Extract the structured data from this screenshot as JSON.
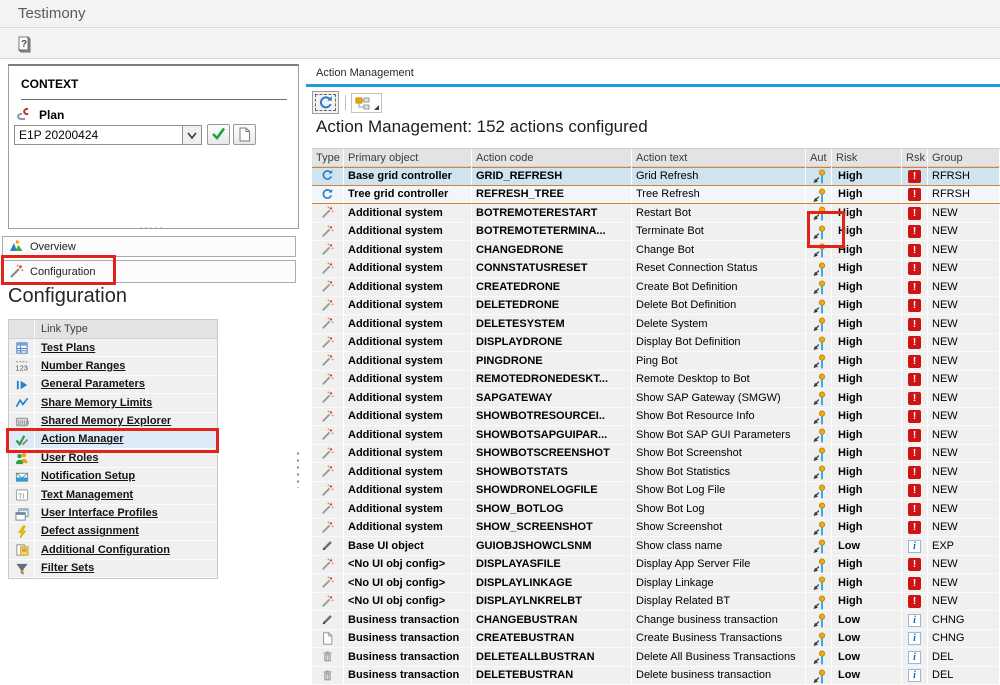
{
  "window": {
    "title": "Testimony"
  },
  "menubar": {
    "help_icon": "help-icon"
  },
  "context": {
    "title": "CONTEXT",
    "plan_label": "Plan",
    "plan_value": "E1P 20200424",
    "buttons": {
      "confirm": "check-icon",
      "create": "new-document-icon"
    }
  },
  "nav": {
    "overview_label": "Overview",
    "configuration_label": "Configuration"
  },
  "sidebar": {
    "heading": "Configuration",
    "column_header": "Link Type",
    "links": [
      {
        "label": "Test Plans",
        "icon": "test-plans-icon",
        "selected": false
      },
      {
        "label": "Number Ranges",
        "icon": "number-ranges-icon",
        "selected": false
      },
      {
        "label": "General Parameters",
        "icon": "general-parameters-icon",
        "selected": false
      },
      {
        "label": "Share Memory Limits",
        "icon": "share-memory-limits-icon",
        "selected": false
      },
      {
        "label": "Shared Memory Explorer",
        "icon": "shared-memory-explorer-icon",
        "selected": false
      },
      {
        "label": "Action Manager",
        "icon": "action-manager-icon",
        "selected": true
      },
      {
        "label": "User Roles",
        "icon": "user-roles-icon",
        "selected": false
      },
      {
        "label": "Notification Setup",
        "icon": "notification-setup-icon",
        "selected": false
      },
      {
        "label": "Text Management",
        "icon": "text-management-icon",
        "selected": false
      },
      {
        "label": "User Interface Profiles",
        "icon": "user-interface-profiles-icon",
        "selected": false
      },
      {
        "label": "Defect assignment",
        "icon": "defect-assignment-icon",
        "selected": false
      },
      {
        "label": "Additional Configuration",
        "icon": "additional-configuration-icon",
        "selected": false
      },
      {
        "label": "Filter Sets",
        "icon": "filter-sets-icon",
        "selected": false
      }
    ]
  },
  "main": {
    "tab_title": "Action Management",
    "toolbar": {
      "refresh_icon": "refresh-icon",
      "layout_icon": "layout-icon"
    },
    "heading": "Action Management: 152  actions configured",
    "table": {
      "columns": [
        "Type",
        "Primary object",
        "Action code",
        "Action text",
        "Aut",
        "Risk",
        "Rsk",
        "Group"
      ],
      "rows": [
        {
          "type_icon": "refresh-icon",
          "primary": "Base grid controller",
          "code": "GRID_REFRESH",
          "text": "Grid Refresh",
          "aut_icon": "authorization-key-icon",
          "risk": "High",
          "rsk_icon": "error-icon",
          "group": "RFRSH",
          "selection": "lead"
        },
        {
          "type_icon": "refresh-icon",
          "primary": "Tree grid controller",
          "code": "REFRESH_TREE",
          "text": "Tree Refresh",
          "aut_icon": "authorization-key-icon",
          "risk": "High",
          "rsk_icon": "error-icon",
          "group": "RFRSH",
          "selection": "second"
        },
        {
          "type_icon": "wand-icon",
          "primary": "Additional system",
          "code": "BOTREMOTERESTART",
          "text": "Restart Bot",
          "aut_icon": "authorization-key-icon",
          "risk": "High",
          "rsk_icon": "error-icon",
          "group": "NEW"
        },
        {
          "type_icon": "wand-icon",
          "primary": "Additional system",
          "code": "BOTREMOTETERMINA...",
          "text": "Terminate Bot",
          "aut_icon": "authorization-key-icon",
          "risk": "High",
          "rsk_icon": "error-icon",
          "group": "NEW"
        },
        {
          "type_icon": "wand-icon",
          "primary": "Additional system",
          "code": "CHANGEDRONE",
          "text": "Change Bot",
          "aut_icon": "authorization-key-icon",
          "risk": "High",
          "rsk_icon": "error-icon",
          "group": "NEW"
        },
        {
          "type_icon": "wand-icon",
          "primary": "Additional system",
          "code": "CONNSTATUSRESET",
          "text": "Reset Connection Status",
          "aut_icon": "authorization-key-icon",
          "risk": "High",
          "rsk_icon": "error-icon",
          "group": "NEW"
        },
        {
          "type_icon": "wand-icon",
          "primary": "Additional system",
          "code": "CREATEDRONE",
          "text": "Create Bot Definition",
          "aut_icon": "authorization-key-icon",
          "risk": "High",
          "rsk_icon": "error-icon",
          "group": "NEW"
        },
        {
          "type_icon": "wand-icon",
          "primary": "Additional system",
          "code": "DELETEDRONE",
          "text": "Delete Bot Definition",
          "aut_icon": "authorization-key-icon",
          "risk": "High",
          "rsk_icon": "error-icon",
          "group": "NEW"
        },
        {
          "type_icon": "wand-icon",
          "primary": "Additional system",
          "code": "DELETESYSTEM",
          "text": "Delete System",
          "aut_icon": "authorization-key-icon",
          "risk": "High",
          "rsk_icon": "error-icon",
          "group": "NEW"
        },
        {
          "type_icon": "wand-icon",
          "primary": "Additional system",
          "code": "DISPLAYDRONE",
          "text": "Display Bot Definition",
          "aut_icon": "authorization-key-icon",
          "risk": "High",
          "rsk_icon": "error-icon",
          "group": "NEW"
        },
        {
          "type_icon": "wand-icon",
          "primary": "Additional system",
          "code": "PINGDRONE",
          "text": "Ping Bot",
          "aut_icon": "authorization-key-icon",
          "risk": "High",
          "rsk_icon": "error-icon",
          "group": "NEW"
        },
        {
          "type_icon": "wand-icon",
          "primary": "Additional system",
          "code": "REMOTEDRONEDESKT...",
          "text": "Remote Desktop to Bot",
          "aut_icon": "authorization-key-icon",
          "risk": "High",
          "rsk_icon": "error-icon",
          "group": "NEW"
        },
        {
          "type_icon": "wand-icon",
          "primary": "Additional system",
          "code": "SAPGATEWAY",
          "text": "Show SAP Gateway (SMGW)",
          "aut_icon": "authorization-key-icon",
          "risk": "High",
          "rsk_icon": "error-icon",
          "group": "NEW"
        },
        {
          "type_icon": "wand-icon",
          "primary": "Additional system",
          "code": "SHOWBOTRESOURCEI..",
          "text": "Show Bot Resource Info",
          "aut_icon": "authorization-key-icon",
          "risk": "High",
          "rsk_icon": "error-icon",
          "group": "NEW"
        },
        {
          "type_icon": "wand-icon",
          "primary": "Additional system",
          "code": "SHOWBOTSAPGUIPAR...",
          "text": "Show Bot SAP GUI Parameters",
          "aut_icon": "authorization-key-icon",
          "risk": "High",
          "rsk_icon": "error-icon",
          "group": "NEW"
        },
        {
          "type_icon": "wand-icon",
          "primary": "Additional system",
          "code": "SHOWBOTSCREENSHOT",
          "text": "Show Bot Screenshot",
          "aut_icon": "authorization-key-icon",
          "risk": "High",
          "rsk_icon": "error-icon",
          "group": "NEW"
        },
        {
          "type_icon": "wand-icon",
          "primary": "Additional system",
          "code": "SHOWBOTSTATS",
          "text": "Show Bot Statistics",
          "aut_icon": "authorization-key-icon",
          "risk": "High",
          "rsk_icon": "error-icon",
          "group": "NEW"
        },
        {
          "type_icon": "wand-icon",
          "primary": "Additional system",
          "code": "SHOWDRONELOGFILE",
          "text": "Show Bot Log File",
          "aut_icon": "authorization-key-icon",
          "risk": "High",
          "rsk_icon": "error-icon",
          "group": "NEW"
        },
        {
          "type_icon": "wand-icon",
          "primary": "Additional system",
          "code": "SHOW_BOTLOG",
          "text": "Show Bot Log",
          "aut_icon": "authorization-key-icon",
          "risk": "High",
          "rsk_icon": "error-icon",
          "group": "NEW"
        },
        {
          "type_icon": "wand-icon",
          "primary": "Additional system",
          "code": "SHOW_SCREENSHOT",
          "text": "Show Screenshot",
          "aut_icon": "authorization-key-icon",
          "risk": "High",
          "rsk_icon": "error-icon",
          "group": "NEW"
        },
        {
          "type_icon": "pencil-icon",
          "primary": "Base UI object",
          "code": "GUIOBJSHOWCLSNM",
          "text": "Show class name",
          "aut_icon": "authorization-key-icon",
          "risk": "Low",
          "rsk_icon": "info-icon",
          "group": "EXP"
        },
        {
          "type_icon": "wand-icon",
          "primary": "<No UI obj config>",
          "code": "DISPLAYASFILE",
          "text": "Display App Server File",
          "aut_icon": "authorization-key-icon",
          "risk": "High",
          "rsk_icon": "error-icon",
          "group": "NEW"
        },
        {
          "type_icon": "wand-icon",
          "primary": "<No UI obj config>",
          "code": "DISPLAYLINKAGE",
          "text": "Display Linkage",
          "aut_icon": "authorization-key-icon",
          "risk": "High",
          "rsk_icon": "error-icon",
          "group": "NEW"
        },
        {
          "type_icon": "wand-icon",
          "primary": "<No UI obj config>",
          "code": "DISPLAYLNKRELBT",
          "text": "Display Related BT",
          "aut_icon": "authorization-key-icon",
          "risk": "High",
          "rsk_icon": "error-icon",
          "group": "NEW"
        },
        {
          "type_icon": "pencil-icon",
          "primary": "Business transaction",
          "code": "CHANGEBUSTRAN",
          "text": "Change business transaction",
          "aut_icon": "authorization-key-icon",
          "risk": "Low",
          "rsk_icon": "info-icon",
          "group": "CHNG"
        },
        {
          "type_icon": "document-icon",
          "primary": "Business transaction",
          "code": "CREATEBUSTRAN",
          "text": "Create Business Transactions",
          "aut_icon": "authorization-key-icon",
          "risk": "Low",
          "rsk_icon": "info-icon",
          "group": "CHNG"
        },
        {
          "type_icon": "trash-icon",
          "primary": "Business transaction",
          "code": "DELETEALLBUSTRAN",
          "text": "Delete All Business Transactions",
          "aut_icon": "authorization-key-icon",
          "risk": "Low",
          "rsk_icon": "info-icon",
          "group": "DEL"
        },
        {
          "type_icon": "trash-icon",
          "primary": "Business transaction",
          "code": "DELETEBUSTRAN",
          "text": "Delete business transaction",
          "aut_icon": "authorization-key-icon",
          "risk": "Low",
          "rsk_icon": "info-icon",
          "group": "DEL"
        }
      ]
    }
  },
  "annotations": {
    "highlight_color": "#e2231a",
    "boxes": [
      {
        "name": "configuration-nav-highlight",
        "target": "Configuration navigation button"
      },
      {
        "name": "action-manager-link-highlight",
        "target": "Action Manager sidebar link"
      },
      {
        "name": "terminate-bot-aut-highlight",
        "target": "Aut icon of Terminate Bot row"
      }
    ]
  },
  "colors": {
    "tab_accent": "#1a9dd9",
    "lead_selection_bg": "#cfe4f1",
    "selection_border": "#d9822b",
    "error_red": "#cd1414",
    "info_blue": "#1567b8",
    "annotation_red": "#e2231a"
  }
}
